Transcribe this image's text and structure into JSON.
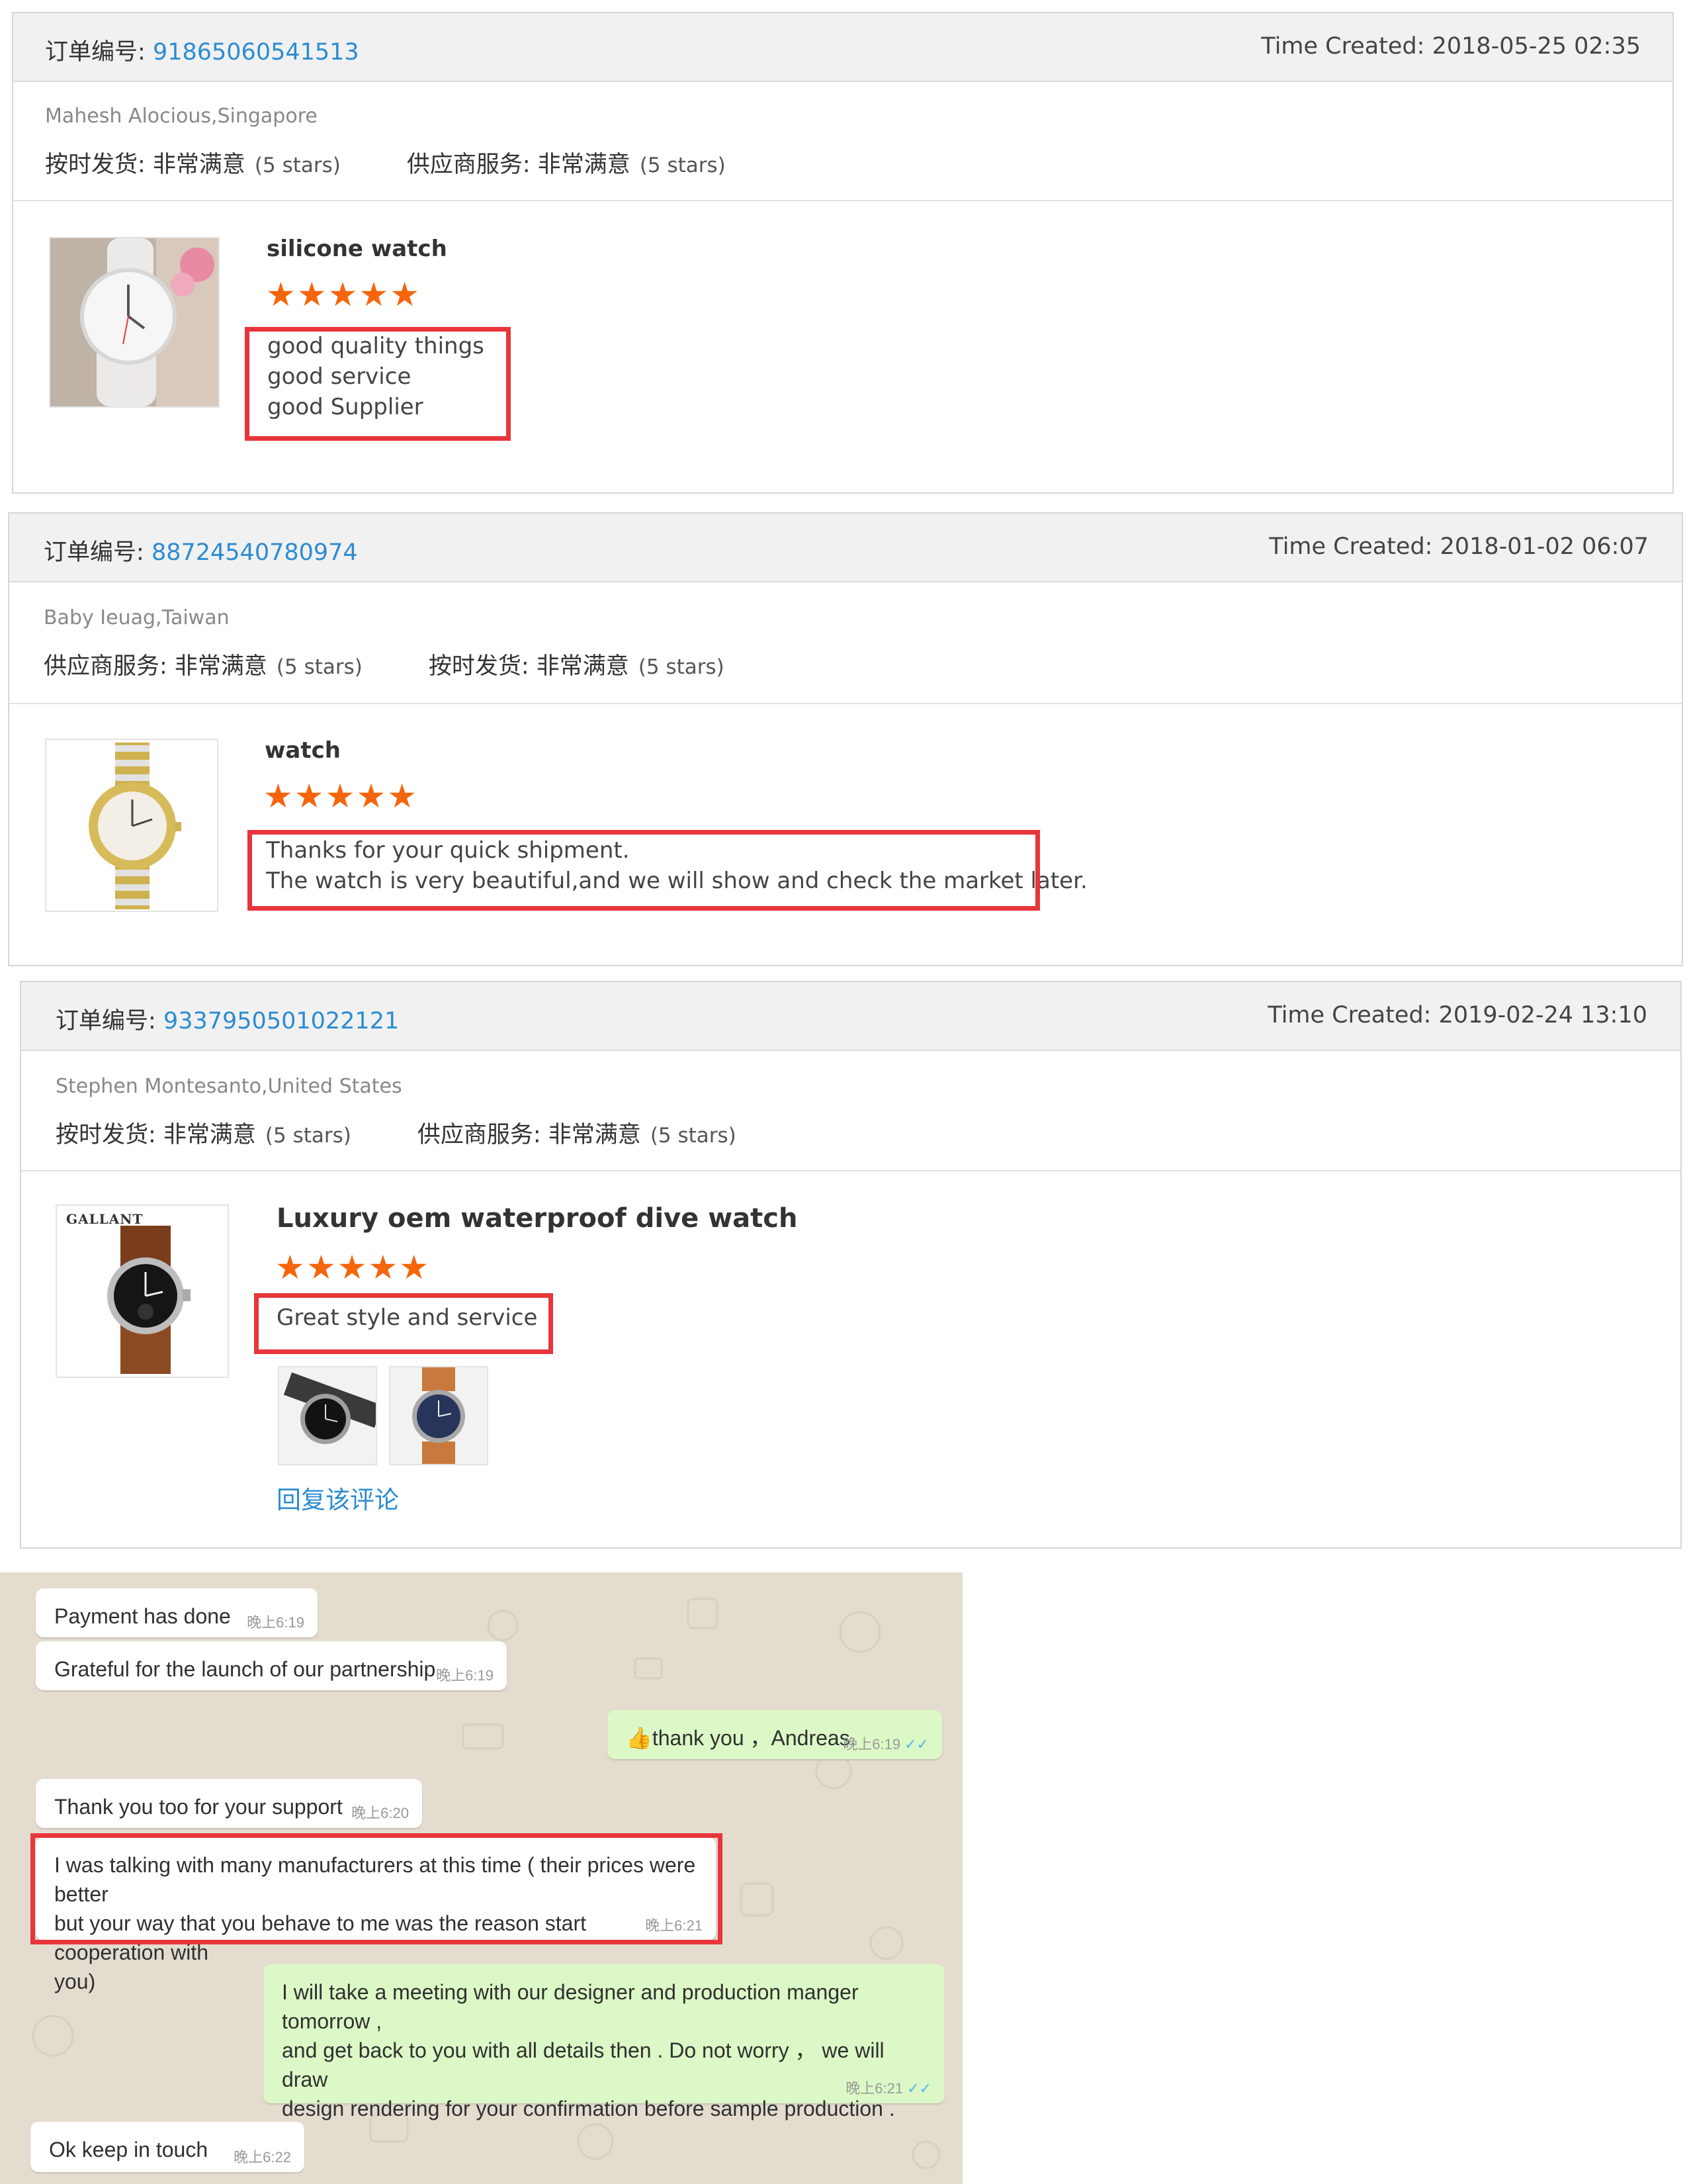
{
  "reviews": [
    {
      "order_label": "订单编号:",
      "order_no": "91865060541513",
      "created": "Time Created: 2018-05-25 02:35",
      "buyer": "Mahesh Alocious,Singapore",
      "rating1_label": "按时发货: 非常满意",
      "rating1_stars": "(5 stars)",
      "rating2_label": "供应商服务: 非常满意",
      "rating2_stars": "(5 stars)",
      "product": "silicone watch",
      "stars": "★★★★★",
      "comment": "good quality things\ngood service\ngood Supplier"
    },
    {
      "order_label": "订单编号:",
      "order_no": "88724540780974",
      "created": "Time Created: 2018-01-02 06:07",
      "buyer": "Baby Ieuag,Taiwan",
      "rating1_label": "供应商服务: 非常满意",
      "rating1_stars": "(5 stars)",
      "rating2_label": "按时发货: 非常满意",
      "rating2_stars": "(5 stars)",
      "product": "watch",
      "stars": "★★★★★",
      "comment": "Thanks for your quick shipment.\nThe watch is very beautiful,and we will show and check the market later."
    },
    {
      "order_label": "订单编号:",
      "order_no": "9337950501022121",
      "created": "Time Created: 2019-02-24 13:10",
      "buyer": "Stephen Montesanto,United States",
      "rating1_label": "按时发货: 非常满意",
      "rating1_stars": "(5 stars)",
      "rating2_label": "供应商服务: 非常满意",
      "rating2_stars": "(5 stars)",
      "product": "Luxury oem waterproof dive watch",
      "stars": "★★★★★",
      "comment": "Great style and service",
      "brand_text": "GALLANT",
      "reply_link": "回复该评论"
    }
  ],
  "chat": {
    "messages": [
      {
        "dir": "in",
        "text": "Payment has done",
        "time": "晚上6:19"
      },
      {
        "dir": "in",
        "text": "Grateful for the launch of our partnership",
        "time": "晚上6:19"
      },
      {
        "dir": "out",
        "text": "thank you ，Andreas.",
        "time": "晚上6:19",
        "icon": "thumbs-up-icon"
      },
      {
        "dir": "in",
        "text": "Thank you too for your support",
        "time": "晚上6:20"
      },
      {
        "dir": "in",
        "text": "I was talking with many manufacturers at this time ( their prices were better\nbut your way that you behave to me was the reason start cooperation with\nyou)",
        "time": "晚上6:21"
      },
      {
        "dir": "out",
        "text": "I will take a meeting with our designer and production manger tomorrow ,\nand get back to you with all details then .  Do not worry ， we will draw\ndesign rendering for your confirmation before sample production .",
        "time": "晚上6:21"
      },
      {
        "dir": "in",
        "text": "Ok keep in touch",
        "time": "晚上6:22"
      }
    ],
    "read_tick": "✓✓",
    "colors": {
      "incoming": "#ffffff",
      "outgoing": "#dcf8c6",
      "background": "#e3dccf",
      "tick": "#4fb6ec"
    }
  },
  "colors": {
    "link": "#2b8cd1",
    "star": "#f5650c",
    "highlight": "#e8353b",
    "header_bg": "#f1f1f1"
  }
}
